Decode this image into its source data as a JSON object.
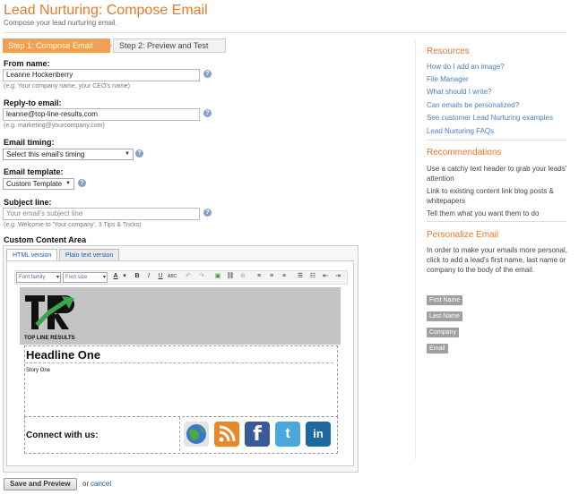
{
  "header": {
    "title": "Lead Nurturing: Compose Email",
    "subtitle": "Compose your lead nurturing email."
  },
  "steps": [
    {
      "label": "Step 1: Compose Email",
      "active": true
    },
    {
      "label": "Step 2: Preview and Test",
      "active": false
    }
  ],
  "form": {
    "from_name": {
      "label": "From name:",
      "value": "Leanne Hockenberry",
      "hint": "(e.g. Your company name, your CEO's name)"
    },
    "reply_to": {
      "label": "Reply-to email:",
      "value": "leanne@top-line-results.com",
      "hint": "(e.g. marketing@yourcompany.com)"
    },
    "timing": {
      "label": "Email timing:",
      "selected": "Select this email's timing"
    },
    "template": {
      "label": "Email template:",
      "selected": "Custom Template"
    },
    "subject": {
      "label": "Subject line:",
      "placeholder": "Your email's subject line",
      "hint": "(e.g. Welcome to 'Your company', 3 Tips & Tricks)"
    },
    "content_area_label": "Custom Content Area"
  },
  "editor": {
    "tabs": [
      "HTML version",
      "Plain text version"
    ],
    "toolbar": {
      "font_family": "Font family",
      "font_size": "Font size"
    },
    "template": {
      "logo_letters": "TLR",
      "logo_caption": "TOP LINE RESULTS",
      "headline": "Headline One",
      "story": "Story One",
      "connect": "Connect with us:"
    },
    "social_icons": [
      "globe-icon",
      "rss-icon",
      "facebook-icon",
      "twitter-icon",
      "linkedin-icon"
    ]
  },
  "actions": {
    "save": "Save and Preview",
    "or": "or",
    "cancel": "cancel"
  },
  "sidebar": {
    "resources": {
      "title": "Resources",
      "links": [
        "How do I add an image?",
        "File Manager",
        "What should I write?",
        "Can emails be personalized?",
        "See customer Lead Nurturing examples",
        "Lead Nurturing FAQs"
      ]
    },
    "recommendations": {
      "title": "Recommendations",
      "items": [
        "Use a catchy text header to grab your leads' attention",
        "Link to existing content link blog posts & whitepapers",
        "Tell them what you want them to do"
      ]
    },
    "personalize": {
      "title": "Personalize Email",
      "description": "In order to make your emails more personal, click to add a lead's first name, last name or company to the body of the email.",
      "tokens": [
        "First Name",
        "Last Name",
        "Company",
        "Email"
      ]
    }
  },
  "colors": {
    "accent": "#e8792c",
    "link": "#4a7fc0",
    "step_active": "#f0a050",
    "rss": "#e8872a",
    "facebook": "#3b5a9a",
    "twitter": "#4aa8dc",
    "linkedin": "#1d6aa0"
  }
}
